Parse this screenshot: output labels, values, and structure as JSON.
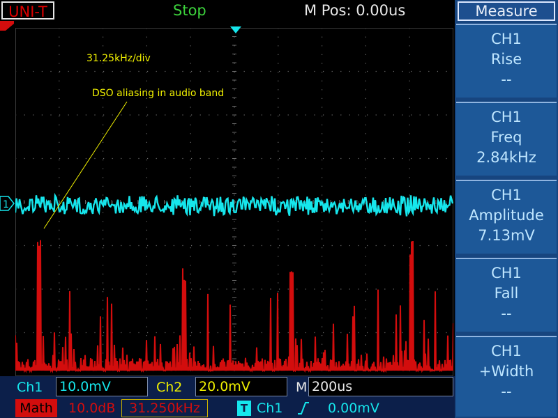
{
  "header": {
    "brand": "UNI-T",
    "run_status": "Stop",
    "m_pos_label": "M Pos: 0.00us",
    "menu_title": "Measure"
  },
  "channel_marker": "1",
  "trigger_marker": "T",
  "annotations": {
    "scale": "31.25kHz/div",
    "aliasing": "DSO aliasing in audio band"
  },
  "measure_menu": [
    {
      "channel": "CH1",
      "measure": "Rise",
      "value": "--"
    },
    {
      "channel": "CH1",
      "measure": "Freq",
      "value": "2.84kHz"
    },
    {
      "channel": "CH1",
      "measure": "Amplitude",
      "value": "7.13mV"
    },
    {
      "channel": "CH1",
      "measure": "Fall",
      "value": "--"
    },
    {
      "channel": "CH1",
      "measure": "+Width",
      "value": "--"
    }
  ],
  "status_bar": {
    "ch1_label": "Ch1",
    "ch1_scale": "10.0mV",
    "ch2_label": "Ch2",
    "ch2_scale": "20.0mV",
    "time_label": "M",
    "time_scale": "200us",
    "math_label": "Math",
    "math_scale": "10.0dB",
    "math_freq": "31.250kHz",
    "trig_icon": "T",
    "trig_source": "Ch1",
    "trig_slope": "rising-edge-icon",
    "trig_level": "0.00mV"
  },
  "colors": {
    "ch1": "#16e6ec",
    "ch2": "#f0f000",
    "math": "#d30d0d",
    "grid": "#6a6a6a",
    "annotation": "#f2f200",
    "menu": "#1d5898",
    "status_bg": "#0c1f4a"
  },
  "traces": {
    "ch1_noise_level_fraction": 0.51,
    "math_fft_peaks": [
      {
        "div": 0.55,
        "height_fraction": 0.41
      },
      {
        "div": 3.85,
        "height_fraction": 0.3
      },
      {
        "div": 6.3,
        "height_fraction": 0.31
      },
      {
        "div": 9.05,
        "height_fraction": 0.39
      }
    ]
  }
}
